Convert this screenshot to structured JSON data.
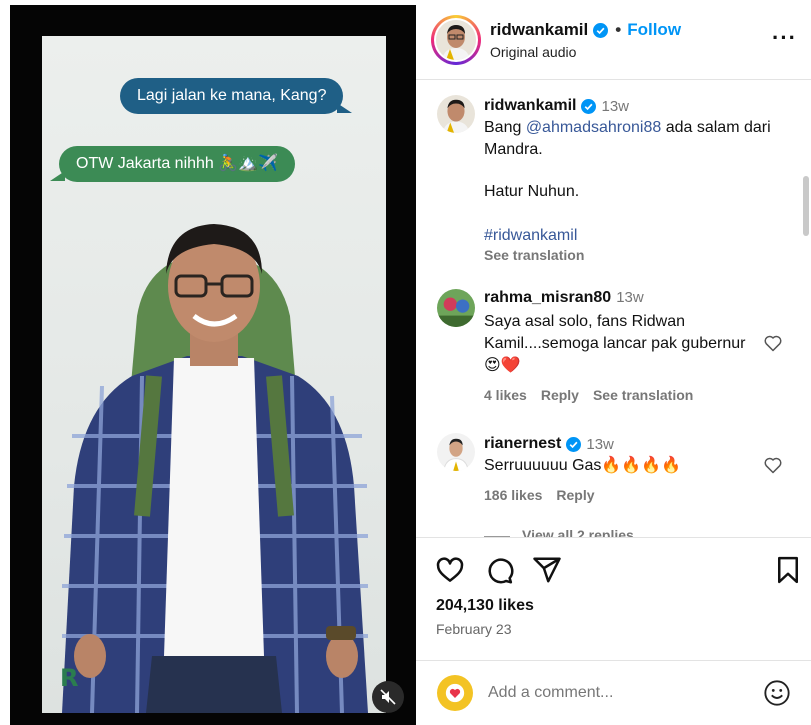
{
  "reel": {
    "bubble_question": "Lagi jalan ke mana, Kang?",
    "bubble_answer": "OTW Jakarta nihhh 🚴🏔️✈️",
    "logo_text": "R"
  },
  "header": {
    "username": "ridwankamil",
    "separator": "•",
    "follow_label": "Follow",
    "audio_label": "Original audio",
    "more_label": "···"
  },
  "caption": {
    "username": "ridwankamil",
    "time": "13w",
    "text_before": "Bang ",
    "mention": "@ahmadsahroni88",
    "text_after": " ada salam dari Mandra.",
    "line2": "Hatur Nuhun.",
    "hashtag": "#ridwankamil",
    "see_translation": "See translation"
  },
  "comments": [
    {
      "username": "rahma_misran80",
      "time": "13w",
      "text": "Saya asal solo, fans Ridwan Kamil....semoga lancar pak gubernur 😍❤️",
      "likes": "4 likes",
      "reply": "Reply",
      "translation": "See translation"
    },
    {
      "username": "rianernest",
      "time": "13w",
      "text": "Serruuuuuu Gas🔥🔥🔥🔥",
      "likes": "186 likes",
      "reply": "Reply",
      "view_replies": "View all 2 replies"
    }
  ],
  "actions": {
    "likes": "204,130 likes",
    "date": "February 23"
  },
  "add_comment": {
    "placeholder": "Add a comment..."
  },
  "colors": {
    "follow": "#0095f6",
    "bubble_blue": "#1f5f86",
    "bubble_green": "#3c8b55",
    "link": "#385898"
  },
  "icons": [
    "verified-badge-icon",
    "more-icon",
    "heart-icon",
    "comment-icon",
    "share-icon",
    "bookmark-icon",
    "mute-icon",
    "emoji-icon"
  ]
}
